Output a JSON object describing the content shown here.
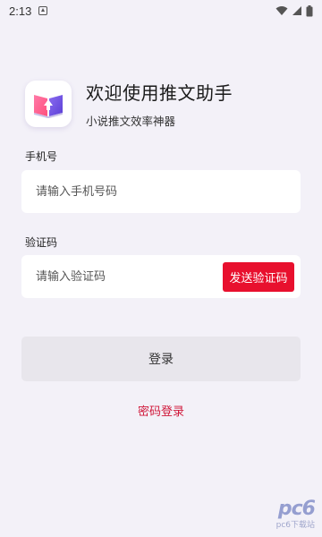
{
  "status_bar": {
    "time": "2:13"
  },
  "header": {
    "title": "欢迎使用推文助手",
    "subtitle": "小说推文效率神器"
  },
  "phone": {
    "label": "手机号",
    "placeholder": "请输入手机号码",
    "value": ""
  },
  "code": {
    "label": "验证码",
    "placeholder": "请输入验证码",
    "value": "",
    "send_button": "发送验证码"
  },
  "login_button": "登录",
  "password_login_link": "密码登录",
  "watermark": {
    "logo": "pc6",
    "text": "pc6下载站"
  },
  "colors": {
    "background": "#f3f1f8",
    "accent_red": "#e8102e",
    "link_red": "#d0183a",
    "login_button_bg": "#e8e6ec"
  }
}
